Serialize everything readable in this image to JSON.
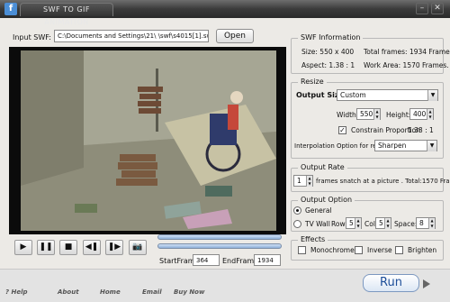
{
  "titlebar": {
    "title": "SWF TO GIF ANIMATION",
    "minimize": "–",
    "close": "✕"
  },
  "input": {
    "label": "Input SWF:",
    "path": "C:\\Documents and Settings\\21\\       \\swf\\s4015[1].sw",
    "open_button": "Open"
  },
  "swf_info": {
    "title": "SWF Information",
    "size": "Size:  550 x 400",
    "total_frames": "Total frames: 1934 Frames.",
    "aspect": "Aspect:  1.38 : 1",
    "work_area": "Work Area: 1570 Frames."
  },
  "resize": {
    "title": "Resize",
    "output_size_label": "Output Size:",
    "output_size_value": "Custom",
    "width_label": "Width:",
    "width_value": "550",
    "height_label": "Height:",
    "height_value": "400",
    "constrain_label": "Constrain Proportion",
    "constrain_ratio": "1.38 : 1",
    "constrain_checked": "✓",
    "interp_label": "Interpolation Option for resize:",
    "interp_value": "Sharpen"
  },
  "output_rate": {
    "title": "Output Rate",
    "value": "1",
    "text": "frames snatch at a picture . Total:1570 Frames."
  },
  "output_option": {
    "title": "Output Option",
    "general": "General",
    "tv_wall": "TV Wall",
    "row_label": "Row:",
    "row_value": "5",
    "col_label": "Col:",
    "col_value": "5",
    "space_label": "Space:",
    "space_value": "8"
  },
  "effects": {
    "title": "Effects",
    "monochrome": "Monochrome",
    "inverse": "Inverse",
    "brighten": "Brighten"
  },
  "transport": {
    "play": "▶",
    "pause": "❚❚",
    "stop": "■",
    "prev": "◀❚",
    "next": "❚▶",
    "snapshot": "📷",
    "start_label": "StartFrame",
    "start_value": "364",
    "end_label": "EndFrame",
    "end_value": "1934"
  },
  "bottom": {
    "help": "? Help",
    "about": "About",
    "home": "Home",
    "email": "Email",
    "buy": "Buy Now",
    "run": "Run"
  },
  "colors": {
    "accent": "#1d4e99",
    "titlebar": "#333333",
    "preview_bg": "#9a9a88"
  }
}
